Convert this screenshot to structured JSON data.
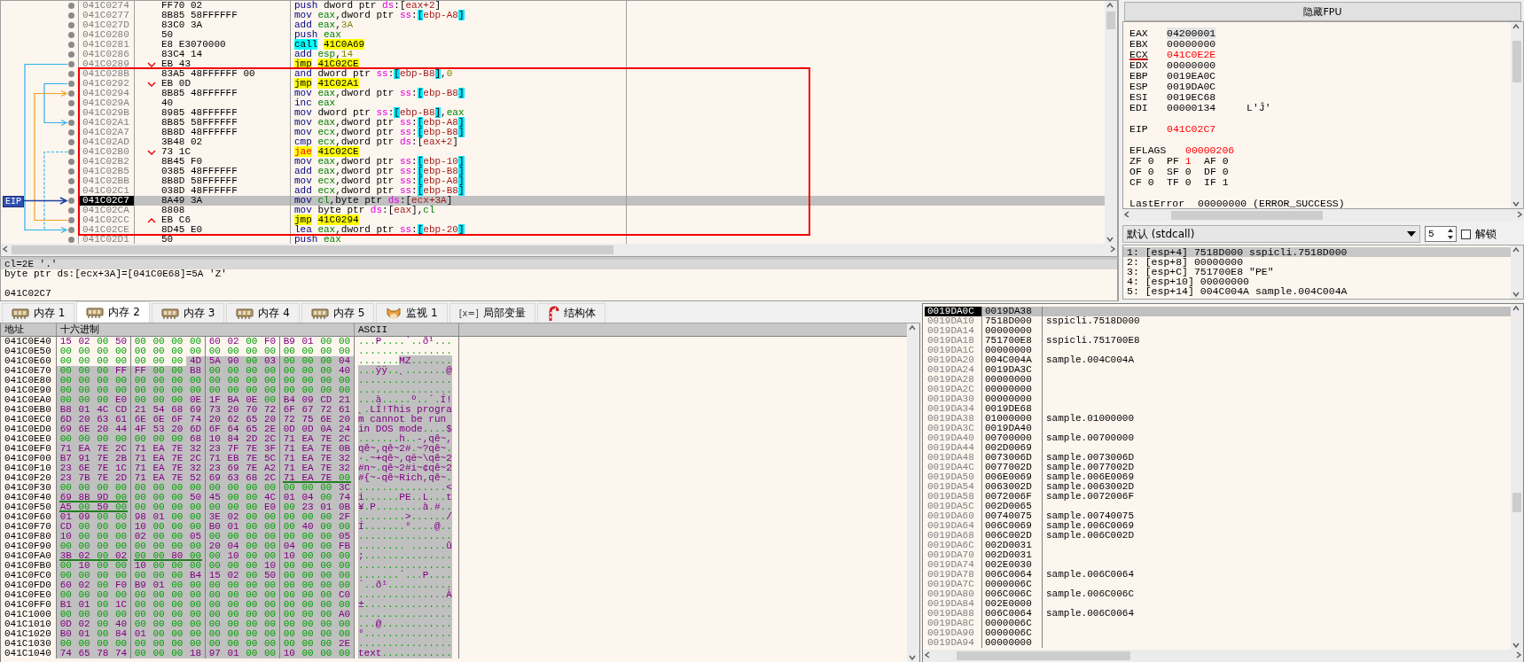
{
  "disassembly": {
    "eip_label": "EIP",
    "rows": [
      {
        "address": "041C0274",
        "bytes": "FF70 02",
        "instruction": "push dword ptr ds:[eax+2]",
        "kind": "plain",
        "selected": false
      },
      {
        "address": "041C0277",
        "bytes": "8B85 58FFFFFF",
        "instruction": "mov eax,dword ptr ss:[ebp-A8]",
        "kind": "plain",
        "selected": false
      },
      {
        "address": "041C027D",
        "bytes": "83C0 3A",
        "instruction": "add eax,3A",
        "kind": "plain",
        "selected": false
      },
      {
        "address": "041C0280",
        "bytes": "50",
        "instruction": "push eax",
        "kind": "plain",
        "selected": false
      },
      {
        "address": "041C0281",
        "bytes": "E8 E3070000",
        "instruction": "call 41C0A69",
        "kind": "call",
        "selected": false
      },
      {
        "address": "041C0286",
        "bytes": "83C4 14",
        "instruction": "add esp,14",
        "kind": "plain",
        "selected": false
      },
      {
        "address": "041C0289",
        "bytes": "EB 43",
        "instruction": "jmp 41C02CE",
        "kind": "jump",
        "branch": {
          "kind": "down"
        },
        "selected": false
      },
      {
        "address": "041C028B",
        "bytes": "83A5 48FFFFFF 00",
        "instruction": "and dword ptr ss:[ebp-B8],0",
        "kind": "plain",
        "selected": false
      },
      {
        "address": "041C0292",
        "bytes": "EB 0D",
        "instruction": "jmp 41C02A1",
        "kind": "jump",
        "branch": {
          "kind": "down"
        },
        "selected": false
      },
      {
        "address": "041C0294",
        "bytes": "8B85 48FFFFFF",
        "instruction": "mov eax,dword ptr ss:[ebp-B8]",
        "kind": "plain",
        "selected": false
      },
      {
        "address": "041C029A",
        "bytes": "40",
        "instruction": "inc eax",
        "kind": "plain",
        "selected": false
      },
      {
        "address": "041C029B",
        "bytes": "8985 48FFFFFF",
        "instruction": "mov dword ptr ss:[ebp-B8],eax",
        "kind": "plain",
        "selected": false
      },
      {
        "address": "041C02A1",
        "bytes": "8B85 58FFFFFF",
        "instruction": "mov eax,dword ptr ss:[ebp-A8]",
        "kind": "plain",
        "selected": false
      },
      {
        "address": "041C02A7",
        "bytes": "8B8D 48FFFFFF",
        "instruction": "mov ecx,dword ptr ss:[ebp-B8]",
        "kind": "plain",
        "selected": false
      },
      {
        "address": "041C02AD",
        "bytes": "3B48 02",
        "instruction": "cmp ecx,dword ptr ds:[eax+2]",
        "kind": "plain",
        "selected": false
      },
      {
        "address": "041C02B0",
        "bytes": "73 1C",
        "instruction": "jae 41C02CE",
        "kind": "cond_jump",
        "branch": {
          "kind": "down"
        },
        "selected": false
      },
      {
        "address": "041C02B2",
        "bytes": "8B45 F0",
        "instruction": "mov eax,dword ptr ss:[ebp-10]",
        "kind": "plain",
        "selected": false
      },
      {
        "address": "041C02B5",
        "bytes": "0385 48FFFFFF",
        "instruction": "add eax,dword ptr ss:[ebp-B8]",
        "kind": "plain",
        "selected": false
      },
      {
        "address": "041C02BB",
        "bytes": "8B8D 58FFFFFF",
        "instruction": "mov ecx,dword ptr ss:[ebp-A8]",
        "kind": "plain",
        "selected": false
      },
      {
        "address": "041C02C1",
        "bytes": "038D 48FFFFFF",
        "instruction": "add ecx,dword ptr ss:[ebp-B8]",
        "kind": "plain",
        "selected": false
      },
      {
        "address": "041C02C7",
        "bytes": "8A49 3A",
        "instruction": "mov cl,byte ptr ds:[ecx+3A]",
        "kind": "plain",
        "selected": true
      },
      {
        "address": "041C02CA",
        "bytes": "8808",
        "instruction": "mov byte ptr ds:[eax],cl",
        "kind": "plain",
        "selected": false
      },
      {
        "address": "041C02CC",
        "bytes": "EB C6",
        "instruction": "jmp 41C0294",
        "kind": "jump",
        "branch": {
          "kind": "up"
        },
        "selected": false
      },
      {
        "address": "041C02CE",
        "bytes": "8D45 E0",
        "instruction": "lea eax,dword ptr ss:[ebp-20]",
        "kind": "plain",
        "selected": false
      },
      {
        "address": "041C02D1",
        "bytes": "50",
        "instruction": "push eax",
        "kind": "plain",
        "selected": false
      }
    ]
  },
  "registers": {
    "header_button": "隐藏FPU",
    "general": [
      {
        "name": "EAX",
        "value": "04200001",
        "changed": false,
        "selected": true,
        "underlined": false
      },
      {
        "name": "EBX",
        "value": "00000000",
        "changed": false,
        "selected": false,
        "underlined": false
      },
      {
        "name": "ECX",
        "value": "041C0E2E",
        "changed": true,
        "selected": false,
        "underlined": true
      },
      {
        "name": "EDX",
        "value": "00000000",
        "changed": false,
        "selected": false,
        "underlined": false
      },
      {
        "name": "EBP",
        "value": "0019EA0C",
        "changed": false,
        "selected": false,
        "underlined": false
      },
      {
        "name": "ESP",
        "value": "0019DA0C",
        "changed": false,
        "selected": false,
        "underlined": false
      },
      {
        "name": "ESI",
        "value": "0019EC68",
        "changed": false,
        "selected": false,
        "underlined": false
      },
      {
        "name": "EDI",
        "value": "00000134",
        "comment": "L'Ĵ'",
        "changed": false,
        "selected": false,
        "underlined": false
      }
    ],
    "eip": {
      "name": "EIP",
      "value": "041C02C7",
      "changed": true
    },
    "eflags": {
      "name": "EFLAGS",
      "value": "00000206",
      "changed": true
    },
    "flags": [
      {
        "name": "ZF",
        "value": "0",
        "changed": false
      },
      {
        "name": "PF",
        "value": "1",
        "changed": true
      },
      {
        "name": "AF",
        "value": "0",
        "changed": false
      },
      {
        "name": "OF",
        "value": "0",
        "changed": false
      },
      {
        "name": "SF",
        "value": "0",
        "changed": false
      },
      {
        "name": "DF",
        "value": "0",
        "changed": false
      },
      {
        "name": "CF",
        "value": "0",
        "changed": false
      },
      {
        "name": "TF",
        "value": "0",
        "changed": false
      },
      {
        "name": "IF",
        "value": "1",
        "changed": false
      }
    ],
    "last_error": {
      "label": "LastError",
      "value": "00000000 (ERROR_SUCCESS)"
    }
  },
  "call_args": {
    "convention": "默认 (stdcall)",
    "count": "5",
    "unlock": {
      "label": "解锁",
      "checked": false
    },
    "rows": [
      {
        "text": "1: [esp+4] 7518D000 sspicli.7518D000",
        "selected": true
      },
      {
        "text": "2: [esp+8] 00000000",
        "selected": false
      },
      {
        "text": "3: [esp+C] 751700E8 \"PE\"",
        "selected": false
      },
      {
        "text": "4: [esp+10] 00000000",
        "selected": false
      },
      {
        "text": "5: [esp+14] 004C004A sample.004C004A",
        "selected": false
      }
    ]
  },
  "info": {
    "lines": [
      {
        "text": "cl=2E '.'",
        "selected": true
      },
      {
        "text": "byte ptr ds:[ecx+3A]=[041C0E68]=5A 'Z'",
        "selected": false
      }
    ],
    "address": "041C02C7"
  },
  "tabs": [
    {
      "label": "内存 1",
      "kind": "memory",
      "selected": false
    },
    {
      "label": "内存 2",
      "kind": "memory",
      "selected": true
    },
    {
      "label": "内存 3",
      "kind": "memory",
      "selected": false
    },
    {
      "label": "内存 4",
      "kind": "memory",
      "selected": false
    },
    {
      "label": "内存 5",
      "kind": "memory",
      "selected": false
    },
    {
      "label": "监视 1",
      "kind": "watch",
      "selected": false
    },
    {
      "label": "局部变量",
      "kind": "locals",
      "icon_text": "[x=]",
      "selected": false
    },
    {
      "label": "结构体",
      "kind": "struct",
      "selected": false
    }
  ],
  "hexdump": {
    "columns": [
      "地址",
      "十六进制",
      "ASCII"
    ],
    "rows": [
      {
        "address": "041C0E40",
        "hex": "15 02 00 50 00 00 00 00 60 02 00 F0 B9 01 00 00",
        "ascii": "...P....`..ð¹..."
      },
      {
        "address": "041C0E50",
        "hex": "00 00 00 00 00 00 00 00 00 00 00 00 00 00 00 00",
        "ascii": "................"
      },
      {
        "address": "041C0E60",
        "hex": "00 00 00 00 00 00 00",
        "hex_selected": "4D 5A 90 00 03 00 00 00 04",
        "ascii": ".......",
        "ascii_selected": "MZ......."
      },
      {
        "address": "041C0E70",
        "hex_selected": "00 00 00 FF FF 00 00 B8 00 00 00 00 00 00 00 40",
        "ascii_selected": "...ÿÿ..¸.......@"
      },
      {
        "address": "041C0E80",
        "hex_selected": "00 00 00 00 00 00 00 00 00 00 00 00 00 00 00 00",
        "ascii_selected": "................"
      },
      {
        "address": "041C0E90",
        "hex_selected": "00 00 00 00 00 00 00 00 00 00 00 00 00 00 00 00",
        "ascii_selected": "................"
      },
      {
        "address": "041C0EA0",
        "hex_selected": "00 00 00 E0 00 00 00 0E 1F BA 0E 00 B4 09 CD 21",
        "ascii_selected": "...à.....º..´.Í!"
      },
      {
        "address": "041C0EB0",
        "hex_selected": "B8 01 4C CD 21 54 68 69 73 20 70 72 6F 67 72 61",
        "ascii_selected": "¸.LÍ!This progra"
      },
      {
        "address": "041C0EC0",
        "hex_selected": "6D 20 63 61 6E 6E 6F 74 20 62 65 20 72 75 6E 20",
        "ascii_selected": "m cannot be run "
      },
      {
        "address": "041C0ED0",
        "hex_selected": "69 6E 20 44 4F 53 20 6D 6F 64 65 2E 0D 0D 0A 24",
        "ascii_selected": "in DOS mode....$"
      },
      {
        "address": "041C0EE0",
        "hex_selected": "00 00 00 00 00 00 00 68 10 84 2D 2C 71 EA 7E 2C",
        "ascii_selected": ".......h..-,qê~,"
      },
      {
        "address": "041C0EF0",
        "hex_selected": "71 EA 7E 2C 71 EA 7E 32 23 7F 7E 3F 71 EA 7E 0B",
        "ascii_selected": "qê~,qê~2#.~?qê~."
      },
      {
        "address": "041C0F00",
        "hex_selected": "B7 91 7E 2B 71 EA 7E 2C 71 EB 7E 5C 71 EA 7E 32",
        "ascii_selected": "·.~+qê~,që~\\qê~2"
      },
      {
        "address": "041C0F10",
        "hex_selected": "23 6E 7E 1C 71 EA 7E 32 23 69 7E A2 71 EA 7E 32",
        "ascii_selected": "#n~.qê~2#i~¢qê~2"
      },
      {
        "address": "041C0F20",
        "hex_selected": "23 7B 7E 2D 71 EA 7E 52 69 63 68 2C 71 EA 7E 00",
        "ascii_selected": "#{~-qê~Rich,qê~.",
        "underlined": [
          false,
          false,
          false,
          true
        ]
      },
      {
        "address": "041C0F30",
        "hex_selected": "00 00 00 00 00 00 00 00 00 00 00 00 00 00 00 3C",
        "ascii_selected": "...............<"
      },
      {
        "address": "041C0F40",
        "hex_selected": "69 8B 9D 00 00 00 00 50 45 00 00 4C 01 04 00 74",
        "ascii_selected": "i......PE..L...t",
        "underlined": [
          true,
          false,
          false,
          false
        ]
      },
      {
        "address": "041C0F50",
        "hex_selected": "A5 00 50 00 00 00 00 00 00 00 00 E0 00 23 01 0B",
        "ascii_selected": "¥.P........à.#..",
        "underlined": [
          true,
          false,
          false,
          false
        ]
      },
      {
        "address": "041C0F60",
        "hex_selected": "01 09 00 00 98 01 00 00 3E 02 00 00 00 00 00 2F",
        "ascii_selected": "........>....../"
      },
      {
        "address": "041C0F70",
        "hex_selected": "CD 00 00 00 10 00 00 00 B0 01 00 00 00 40 00 00",
        "ascii_selected": "Í.......°....@.."
      },
      {
        "address": "041C0F80",
        "hex_selected": "10 00 00 00 02 00 00 05 00 00 00 00 00 00 00 05",
        "ascii_selected": "................"
      },
      {
        "address": "041C0F90",
        "hex_selected": "00 00 00 00 00 00 00 00 20 04 00 00 04 00 00 FB",
        "ascii_selected": "........ ......û"
      },
      {
        "address": "041C0FA0",
        "hex_selected": "3B 02 00 02 00 00 80 00 00 10 00 00 10 00 00 00",
        "ascii_selected": ";...............",
        "underlined": [
          true,
          true,
          false,
          false
        ]
      },
      {
        "address": "041C0FB0",
        "hex_selected": "00 10 00 00 10 00 00 00 00 00 00 10 00 00 00 00",
        "ascii_selected": "................"
      },
      {
        "address": "041C0FC0",
        "hex_selected": "00 00 00 00 00 00 00 B4 15 02 00 50 00 00 00 00",
        "ascii_selected": ".......´...P...."
      },
      {
        "address": "041C0FD0",
        "hex_selected": "60 02 00 F0 B9 01 00 00 00 00 00 00 00 00 00 00",
        "ascii_selected": "`..ð¹..........."
      },
      {
        "address": "041C0FE0",
        "hex_selected": "00 00 00 00 00 00 00 00 00 00 00 00 00 00 00 C0",
        "ascii_selected": "...............À"
      },
      {
        "address": "041C0FF0",
        "hex_selected": "B1 01 00 1C 00 00 00 00 00 00 00 00 00 00 00 00",
        "ascii_selected": "±..............."
      },
      {
        "address": "041C1000",
        "hex_selected": "00 00 00 00 00 00 00 00 00 00 00 00 00 00 00 A0",
        "ascii_selected": "................"
      },
      {
        "address": "041C1010",
        "hex_selected": "0D 02 00 40 00 00 00 00 00 00 00 00 00 00 00 00",
        "ascii_selected": "...@............"
      },
      {
        "address": "041C1020",
        "hex_selected": "B0 01 00 84 01 00 00 00 00 00 00 00 00 00 00 00",
        "ascii_selected": "°..............."
      },
      {
        "address": "041C1030",
        "hex_selected": "00 00 00 00 00 00 00 00 00 00 00 00 00 00 00 2E",
        "ascii_selected": "................"
      },
      {
        "address": "041C1040",
        "hex_selected": "74 65 78 74 00 00 00 18 97 01 00 00 10 00 00 00",
        "ascii_selected": "text............"
      }
    ]
  },
  "stack": {
    "rows": [
      {
        "address": "0019DA0C",
        "value": "0019DA38",
        "selected": true
      },
      {
        "address": "0019DA10",
        "value": "7518D000",
        "comment": "sspicli.7518D000",
        "selected": false
      },
      {
        "address": "0019DA14",
        "value": "00000000",
        "selected": false
      },
      {
        "address": "0019DA18",
        "value": "751700E8",
        "comment": "sspicli.751700E8",
        "selected": false
      },
      {
        "address": "0019DA1C",
        "value": "00000000",
        "selected": false
      },
      {
        "address": "0019DA20",
        "value": "004C004A",
        "comment": "sample.004C004A",
        "selected": false
      },
      {
        "address": "0019DA24",
        "value": "0019DA3C",
        "selected": false
      },
      {
        "address": "0019DA28",
        "value": "00000000",
        "selected": false
      },
      {
        "address": "0019DA2C",
        "value": "00000000",
        "selected": false
      },
      {
        "address": "0019DA30",
        "value": "00000000",
        "selected": false
      },
      {
        "address": "0019DA34",
        "value": "0019DE68",
        "selected": false
      },
      {
        "address": "0019DA38",
        "value": "01000000",
        "comment": "sample.01000000",
        "selected": false
      },
      {
        "address": "0019DA3C",
        "value": "0019DA40",
        "selected": false
      },
      {
        "address": "0019DA40",
        "value": "00700000",
        "comment": "sample.00700000",
        "selected": false
      },
      {
        "address": "0019DA44",
        "value": "002D0069",
        "selected": false
      },
      {
        "address": "0019DA48",
        "value": "0073006D",
        "comment": "sample.0073006D",
        "selected": false
      },
      {
        "address": "0019DA4C",
        "value": "0077002D",
        "comment": "sample.0077002D",
        "selected": false
      },
      {
        "address": "0019DA50",
        "value": "006E0069",
        "comment": "sample.006E0069",
        "selected": false
      },
      {
        "address": "0019DA54",
        "value": "0063002D",
        "comment": "sample.0063002D",
        "selected": false
      },
      {
        "address": "0019DA58",
        "value": "0072006F",
        "comment": "sample.0072006F",
        "selected": false
      },
      {
        "address": "0019DA5C",
        "value": "002D0065",
        "selected": false
      },
      {
        "address": "0019DA60",
        "value": "00740075",
        "comment": "sample.00740075",
        "selected": false
      },
      {
        "address": "0019DA64",
        "value": "006C0069",
        "comment": "sample.006C0069",
        "selected": false
      },
      {
        "address": "0019DA68",
        "value": "006C002D",
        "comment": "sample.006C002D",
        "selected": false
      },
      {
        "address": "0019DA6C",
        "value": "002D0031",
        "selected": false
      },
      {
        "address": "0019DA70",
        "value": "002D0031",
        "selected": false
      },
      {
        "address": "0019DA74",
        "value": "002E0030",
        "selected": false
      },
      {
        "address": "0019DA78",
        "value": "006C0064",
        "comment": "sample.006C0064",
        "selected": false
      },
      {
        "address": "0019DA7C",
        "value": "0000006C",
        "selected": false
      },
      {
        "address": "0019DA80",
        "value": "006C006C",
        "comment": "sample.006C006C",
        "selected": false
      },
      {
        "address": "0019DA84",
        "value": "002E0000",
        "selected": false
      },
      {
        "address": "0019DA88",
        "value": "006C0064",
        "comment": "sample.006C0064",
        "selected": false
      },
      {
        "address": "0019DA8C",
        "value": "0000006C",
        "selected": false
      },
      {
        "address": "0019DA90",
        "value": "0000006C",
        "selected": false
      },
      {
        "address": "0019DA94",
        "value": "00000000",
        "selected": false
      }
    ]
  }
}
